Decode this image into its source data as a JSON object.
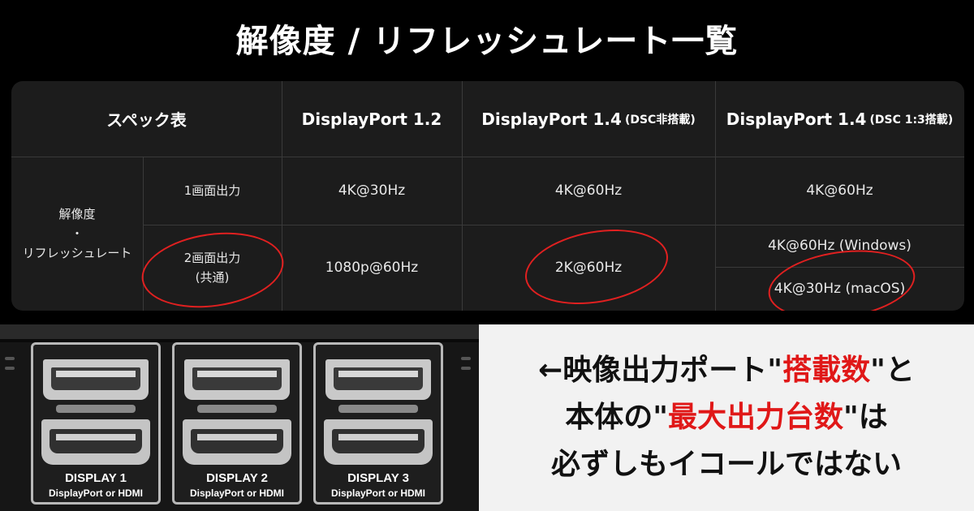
{
  "title": "解像度 / リフレッシュレート一覧",
  "table": {
    "spec_label": "スペック表",
    "columns": [
      {
        "name": "DisplayPort 1.2",
        "note": ""
      },
      {
        "name": "DisplayPort 1.4",
        "note": "(DSC非搭載)"
      },
      {
        "name": "DisplayPort 1.4",
        "note": "(DSC 1:3搭載)"
      }
    ],
    "row_group": {
      "line1": "解像度",
      "line2": "・",
      "line3": "リフレッシュレート"
    },
    "rows": [
      {
        "label_line1": "1画面出力",
        "label_line2": "",
        "values": [
          "4K@30Hz",
          "4K@60Hz",
          "4K@60Hz"
        ]
      },
      {
        "label_line1": "2画面出力",
        "label_line2": "(共通)",
        "values": [
          "1080p@60Hz",
          "2K@60Hz"
        ],
        "split_values": [
          "4K@60Hz (Windows)",
          "4K@30Hz (macOS)"
        ]
      }
    ]
  },
  "displays": [
    {
      "label": "DISPLAY 1",
      "sub": "DisplayPort or HDMI"
    },
    {
      "label": "DISPLAY 2",
      "sub": "DisplayPort or HDMI"
    },
    {
      "label": "DISPLAY 3",
      "sub": "DisplayPort or HDMI"
    }
  ],
  "note": {
    "line1_pre": "←映像出力ポート\"",
    "line1_red": "搭載数",
    "line1_post": "\"と",
    "line2_pre": "本体の\"",
    "line2_red": "最大出力台数",
    "line2_post": "\"は",
    "line3": "必ずしもイコールではない"
  },
  "colors": {
    "accent_red": "#e01818",
    "table_bg": "#1c1c1c",
    "note_bg": "#f2f2f2"
  }
}
